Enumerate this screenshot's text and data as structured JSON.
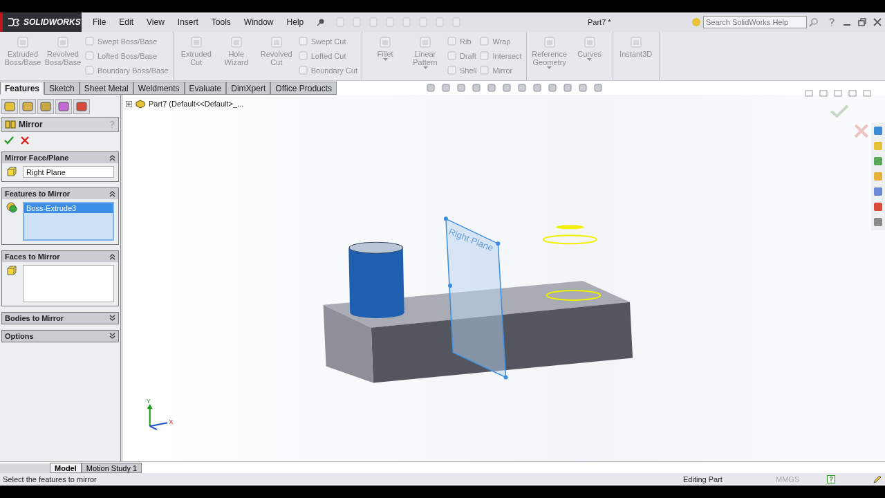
{
  "app": {
    "logo": "SOLIDWORKS",
    "menu": [
      "File",
      "Edit",
      "View",
      "Insert",
      "Tools",
      "Window",
      "Help"
    ],
    "document_title": "Part7 *",
    "search": {
      "placeholder": "Search SolidWorks Help"
    }
  },
  "ribbon": [
    {
      "columns": [
        {
          "kind": "large",
          "label": "Extruded Boss/Base"
        },
        {
          "kind": "large",
          "label": "Revolved Boss/Base"
        },
        {
          "kind": "stack",
          "items": [
            "Swept Boss/Base",
            "Lofted Boss/Base",
            "Boundary Boss/Base"
          ]
        }
      ]
    },
    {
      "columns": [
        {
          "kind": "large",
          "label": "Extruded Cut"
        },
        {
          "kind": "large",
          "label": "Hole Wizard"
        },
        {
          "kind": "large",
          "label": "Revolved Cut"
        },
        {
          "kind": "stack",
          "items": [
            "Swept Cut",
            "Lofted Cut",
            "Boundary Cut"
          ]
        }
      ]
    },
    {
      "columns": [
        {
          "kind": "large",
          "label": "Fillet",
          "dropdown": true
        },
        {
          "kind": "large",
          "label": "Linear Pattern",
          "dropdown": true
        },
        {
          "kind": "stack",
          "items": [
            "Rib",
            "Draft",
            "Shell"
          ]
        },
        {
          "kind": "stack",
          "items": [
            "Wrap",
            "Intersect",
            "Mirror"
          ]
        }
      ]
    },
    {
      "columns": [
        {
          "kind": "large",
          "label": "Reference Geometry",
          "dropdown": true
        },
        {
          "kind": "large",
          "label": "Curves",
          "dropdown": true
        }
      ]
    },
    {
      "columns": [
        {
          "kind": "large",
          "label": "Instant3D"
        }
      ]
    }
  ],
  "tabs": [
    {
      "label": "Features",
      "selected": true
    },
    {
      "label": "Sketch",
      "selected": false
    },
    {
      "label": "Sheet Metal",
      "selected": false
    },
    {
      "label": "Weldments",
      "selected": false
    },
    {
      "label": "Evaluate",
      "selected": false
    },
    {
      "label": "DimXpert",
      "selected": false
    },
    {
      "label": "Office Products",
      "selected": false
    }
  ],
  "property_manager": {
    "title": "Mirror",
    "sections": [
      {
        "title": "Mirror Face/Plane",
        "expanded": true,
        "kind": "field",
        "value": "Right Plane"
      },
      {
        "title": "Features to Mirror",
        "expanded": true,
        "kind": "list",
        "active": true,
        "items": [
          {
            "label": "Boss-Extrude3",
            "selected": true
          }
        ]
      },
      {
        "title": "Faces to Mirror",
        "expanded": true,
        "kind": "list",
        "active": false
      },
      {
        "title": "Bodies to Mirror",
        "expanded": false
      },
      {
        "title": "Options",
        "expanded": false
      }
    ]
  },
  "tree": {
    "label": "Part7  (Default<<Default>_..."
  },
  "viewport": {
    "plane_label": "Right Plane",
    "triad": {
      "y": "Y",
      "x": "X"
    }
  },
  "bottom_tabs": [
    {
      "label": "Model",
      "selected": true
    },
    {
      "label": "Motion Study 1",
      "selected": false
    }
  ],
  "status_bar": {
    "message": "Select the features to mirror",
    "mode": "Editing Part",
    "units": "MMGS"
  }
}
